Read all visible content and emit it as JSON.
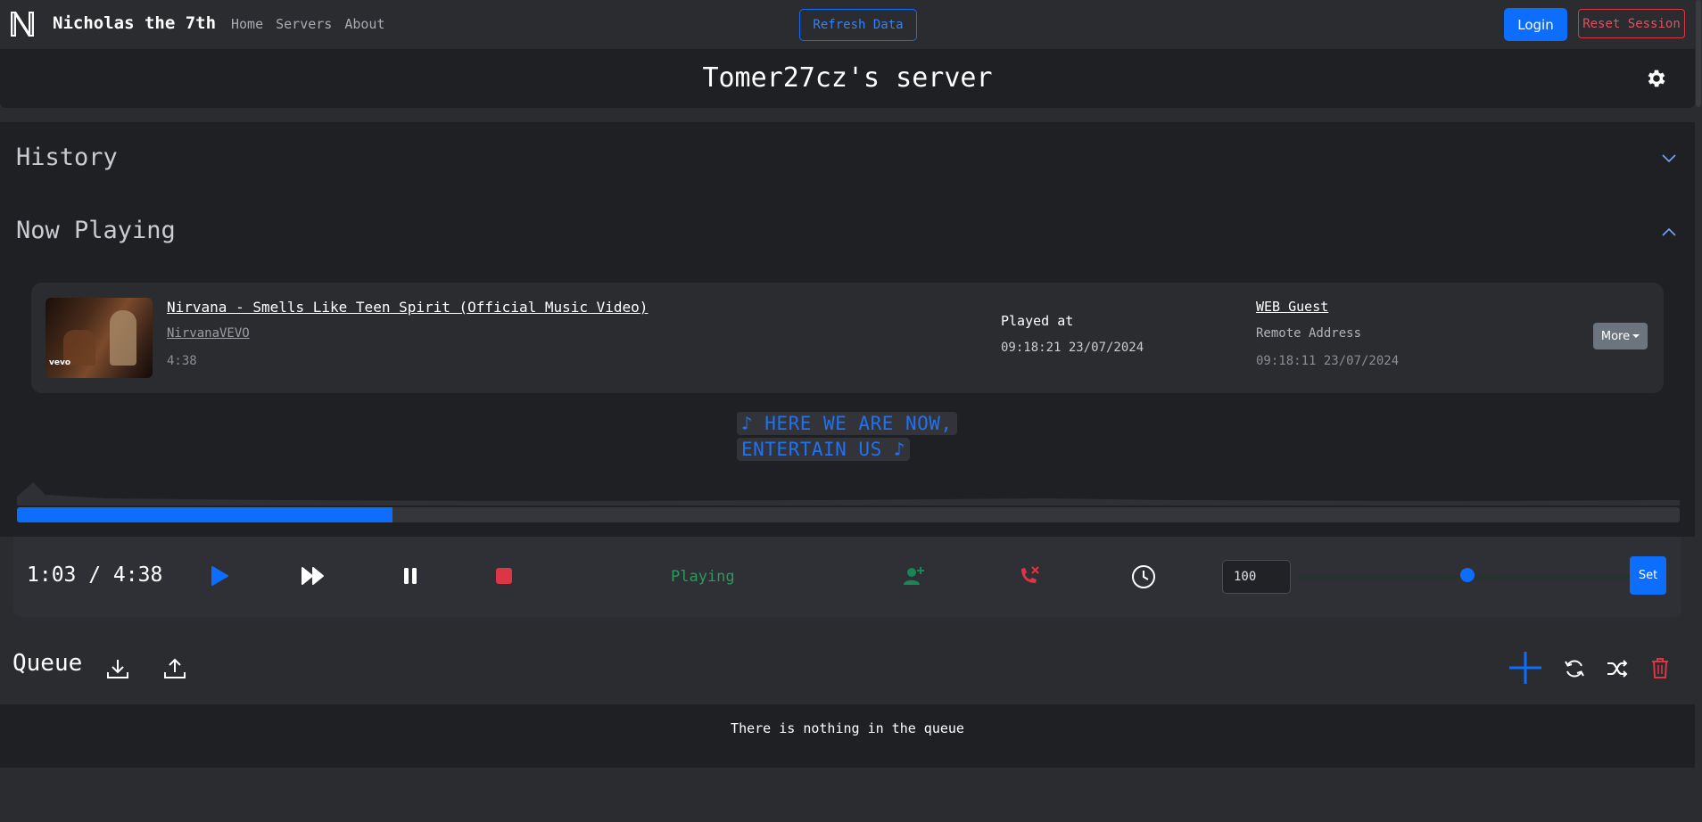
{
  "navbar": {
    "brand": "Nicholas the 7th",
    "links": [
      "Home",
      "Servers",
      "About"
    ],
    "refresh_label": "Refresh Data",
    "login_label": "Login",
    "reset_label": "Reset Session"
  },
  "server": {
    "title": "Tomer27cz's server"
  },
  "sections": {
    "history_label": "History",
    "now_playing_label": "Now Playing"
  },
  "now_playing": {
    "title": "Nirvana - Smells Like Teen Spirit (Official Music Video)",
    "channel": "NirvanaVEVO",
    "duration": "4:38",
    "thumb_watermark": "vevo",
    "played_at_label": "Played at",
    "played_at": "09:18:21 23/07/2024",
    "user": "WEB Guest",
    "remote_label": "Remote Address",
    "remote_time": "09:18:11 23/07/2024",
    "more_label": "More"
  },
  "lyrics": [
    "♪ HERE WE ARE NOW,",
    "ENTERTAIN US ♪"
  ],
  "progress": {
    "fraction": 0.226
  },
  "controls": {
    "time": "1:03 / 4:38",
    "status": "Playing",
    "volume_value": "100",
    "volume_fraction": 0.5,
    "set_label": "Set"
  },
  "queue": {
    "title": "Queue",
    "empty_message": "There is nothing in the queue"
  },
  "colors": {
    "accent": "#0d6efd",
    "danger": "#dc3545",
    "success": "#198754",
    "panel": "#1f2024",
    "background": "#2b2c30"
  },
  "icons": [
    "logo-icon",
    "gear-icon",
    "chevron-down-icon",
    "chevron-up-icon",
    "play-icon",
    "skip-icon",
    "pause-icon",
    "stop-icon",
    "add-user-icon",
    "disconnect-icon",
    "clock-icon",
    "download-icon",
    "upload-icon",
    "plus-icon",
    "refresh-icon",
    "shuffle-icon",
    "trash-icon"
  ]
}
